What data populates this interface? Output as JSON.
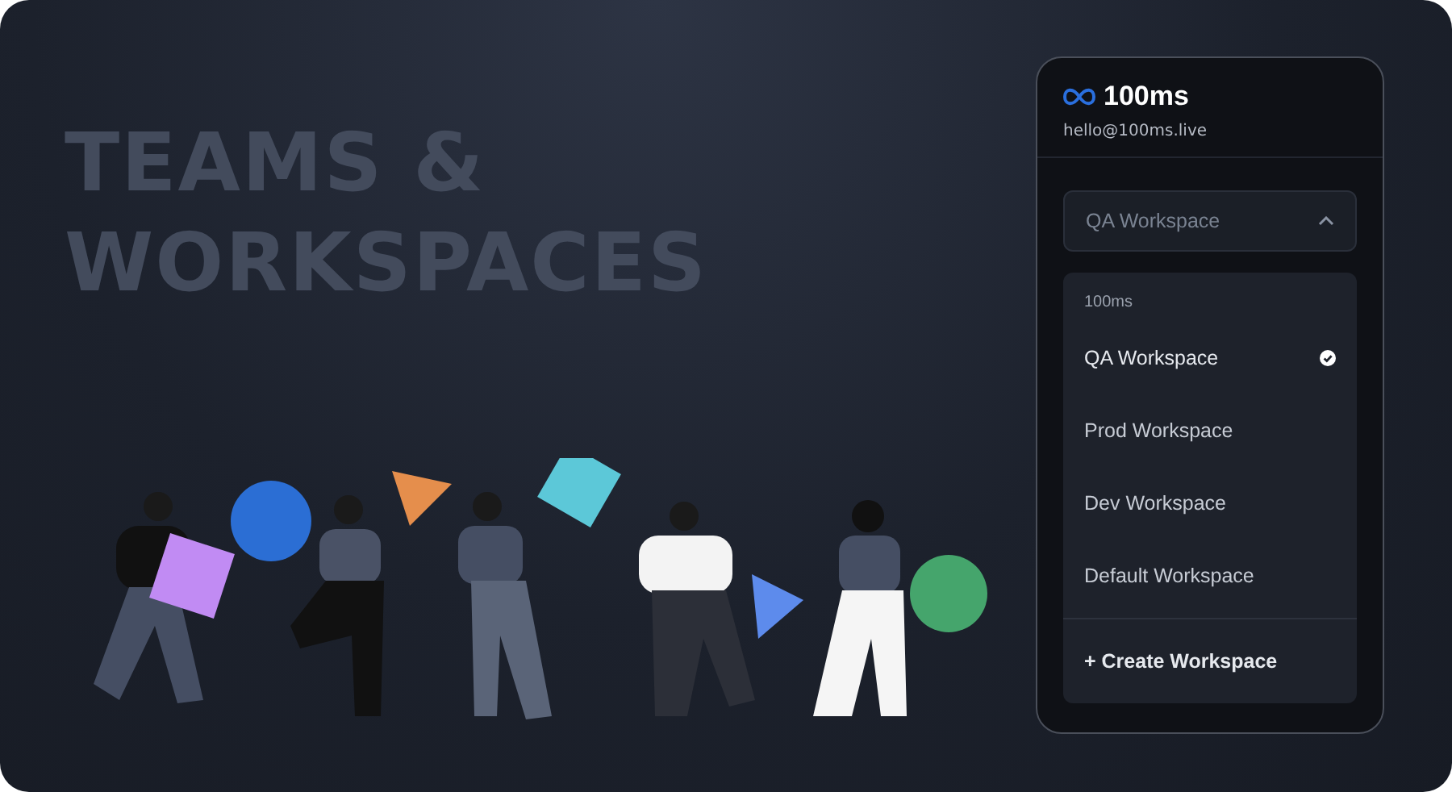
{
  "heading": {
    "lines": [
      "TEAMS &",
      "WORKSPACES"
    ]
  },
  "panel": {
    "brand": "100ms",
    "email": "hello@100ms.live",
    "select": {
      "value": "QA Workspace",
      "expanded": true
    },
    "menu": {
      "group_label": "100ms",
      "items": [
        {
          "label": "QA Workspace",
          "selected": true
        },
        {
          "label": "Prod Workspace",
          "selected": false
        },
        {
          "label": "Dev Workspace",
          "selected": false
        },
        {
          "label": "Default Workspace",
          "selected": false
        }
      ],
      "action": "+ Create Workspace"
    }
  }
}
